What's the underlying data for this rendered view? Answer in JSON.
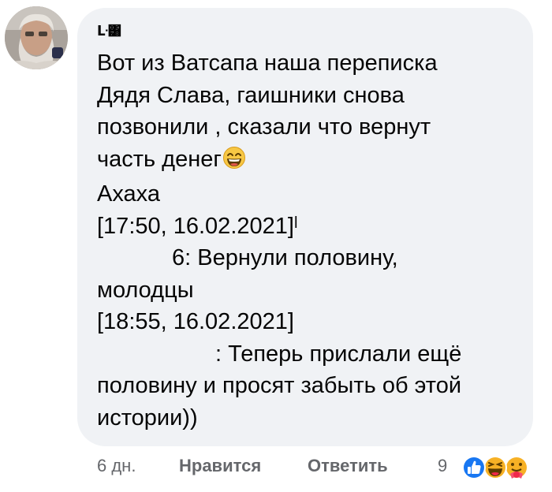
{
  "comment": {
    "author": "ᒷ͸",
    "lines": [
      "Вот из Ватсапа наша переписка",
      "Дядя Слава, гаишники снова",
      "позвонили , сказали что вернут",
      "часть денег",
      "Ахаха",
      "[17:50, 16.02.2021]",
      "6: Вернули половину,",
      "молодцы",
      "[18:55, 16.02.2021]",
      ": Теперь прислали ещё",
      "половину и просят забыть об этой",
      "истории))"
    ]
  },
  "footer": {
    "time": "6 дн.",
    "like_label": "Нравится",
    "reply_label": "Ответить",
    "reaction_count": "9"
  },
  "reactions": [
    "like-reaction",
    "haha-reaction",
    "care-reaction"
  ],
  "colors": {
    "bubble": "#f0f2f5",
    "text": "#050505",
    "meta": "#65676b",
    "like_blue": "#1877f2",
    "emoji_yellow": "#f7b125"
  }
}
